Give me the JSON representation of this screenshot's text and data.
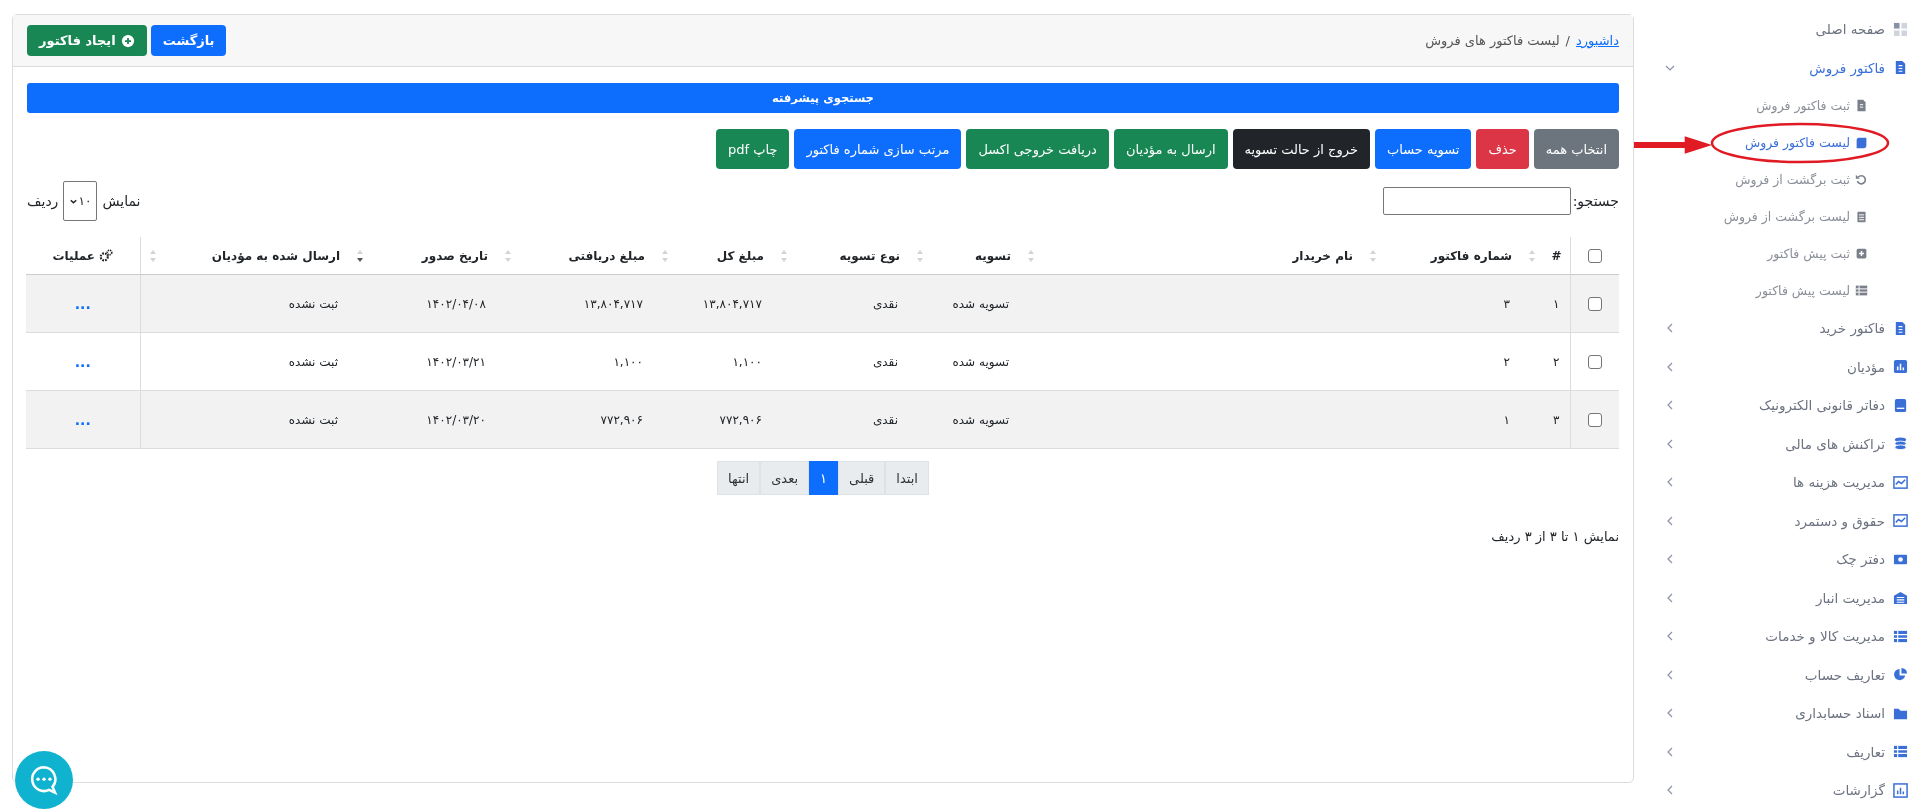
{
  "breadcrumb": {
    "link": "داشبورد",
    "separator": "/",
    "current": "لیست فاکتور های فروش"
  },
  "header_buttons": [
    {
      "label": "بازگشت"
    },
    {
      "label": "ایجاد فاکتور"
    }
  ],
  "advanced_search": {
    "label": "جستجوی پیشرفته"
  },
  "actions": [
    {
      "label": "انتخاب همه"
    },
    {
      "label": "حذف"
    },
    {
      "label": "تسویه حساب"
    },
    {
      "label": "خروج از حالت تسویه"
    },
    {
      "label": "ارسال به مؤدیان"
    },
    {
      "label": "دریافت خروجی اکسل"
    },
    {
      "label": "مرتب سازی شماره فاکتور"
    },
    {
      "label": "چاپ pdf"
    }
  ],
  "search": {
    "label": "جستجو:"
  },
  "page_length": {
    "before": "نمایش",
    "value": "۱۰",
    "after": "ردیف"
  },
  "table": {
    "select_all": {
      "checked": false
    },
    "columns": [
      {
        "label": "#",
        "kind": "sortable",
        "sorted": false
      },
      {
        "label": "شماره فاکتور",
        "kind": "sortable",
        "sorted": false
      },
      {
        "label": "نام خریدار",
        "kind": "sortable",
        "sorted": false
      },
      {
        "label": "تسویه",
        "kind": "sortable",
        "sorted": false
      },
      {
        "label": "نوع تسویه",
        "kind": "sortable",
        "sorted": false
      },
      {
        "label": "مبلغ کل",
        "kind": "sortable",
        "sorted": false
      },
      {
        "label": "مبلغ دریافتی",
        "kind": "sortable",
        "sorted": false
      },
      {
        "label": "تاریخ صدور",
        "kind": "sortable",
        "sorted": true
      },
      {
        "label": "ارسال شده به مؤدیان",
        "kind": "sortable",
        "sorted": false
      },
      {
        "label": "عملیات",
        "kind": "actions"
      }
    ],
    "rows": [
      {
        "checked": false,
        "cells": [
          "۱",
          "۳",
          "",
          "تسویه شده",
          "نقدی",
          "۱۳,۸۰۴,۷۱۷",
          "۱۳,۸۰۴,۷۱۷",
          "۱۴۰۲/۰۴/۰۸",
          "ثبت نشده",
          "..."
        ]
      },
      {
        "checked": false,
        "cells": [
          "۲",
          "۲",
          "",
          "تسویه شده",
          "نقدی",
          "۱,۱۰۰",
          "۱,۱۰۰",
          "۱۴۰۲/۰۳/۲۱",
          "ثبت نشده",
          "..."
        ]
      },
      {
        "checked": false,
        "cells": [
          "۳",
          "۱",
          "",
          "تسویه شده",
          "نقدی",
          "۷۷۲,۹۰۶",
          "۷۷۲,۹۰۶",
          "۱۴۰۲/۰۳/۲۰",
          "ثبت نشده",
          "..."
        ]
      }
    ]
  },
  "pagination": [
    {
      "label": "ابتدا",
      "selected": false
    },
    {
      "label": "قبلی",
      "selected": false
    },
    {
      "label": "۱",
      "selected": true
    },
    {
      "label": "بعدی",
      "selected": false
    },
    {
      "label": "انتها",
      "selected": false
    }
  ],
  "info": "نمایش ۱ تا ۳ از ۳ ردیف",
  "sidebar": {
    "items": [
      {
        "label": "صفحه اصلی",
        "expandable": false,
        "expanded": false
      },
      {
        "label": "فاکتور فروش",
        "expandable": true,
        "expanded": true,
        "children": [
          {
            "label": "ثبت فاکتور فروش",
            "selected": false,
            "annotated": false
          },
          {
            "label": "لیست فاکتور فروش",
            "selected": true,
            "annotated": true
          },
          {
            "label": "ثبت برگشت از فروش",
            "selected": false,
            "annotated": false
          },
          {
            "label": "لیست برگشت از فروش",
            "selected": false,
            "annotated": false
          },
          {
            "label": "ثبت پیش فاکتور",
            "selected": false,
            "annotated": false
          },
          {
            "label": "لیست پیش فاکتور",
            "selected": false,
            "annotated": false
          }
        ]
      },
      {
        "label": "فاکتور خرید",
        "expandable": true,
        "expanded": false
      },
      {
        "label": "مؤدیان",
        "expandable": true,
        "expanded": false
      },
      {
        "label": "دفاتر قانونی الکترونیک",
        "expandable": true,
        "expanded": false
      },
      {
        "label": "تراکنش های مالی",
        "expandable": true,
        "expanded": false
      },
      {
        "label": "مدیریت هزینه ها",
        "expandable": true,
        "expanded": false
      },
      {
        "label": "حقوق و دستمرد",
        "expandable": true,
        "expanded": false
      },
      {
        "label": "دفتر چک",
        "expandable": true,
        "expanded": false
      },
      {
        "label": "مدیریت انبار",
        "expandable": true,
        "expanded": false
      },
      {
        "label": "مدیریت کالا و خدمات",
        "expandable": true,
        "expanded": false
      },
      {
        "label": "تعاریف حساب",
        "expandable": true,
        "expanded": false
      },
      {
        "label": "اسناد حسابداری",
        "expandable": true,
        "expanded": false
      },
      {
        "label": "تعاریف",
        "expandable": true,
        "expanded": false
      },
      {
        "label": "گزارشات",
        "expandable": true,
        "expanded": false
      }
    ]
  }
}
